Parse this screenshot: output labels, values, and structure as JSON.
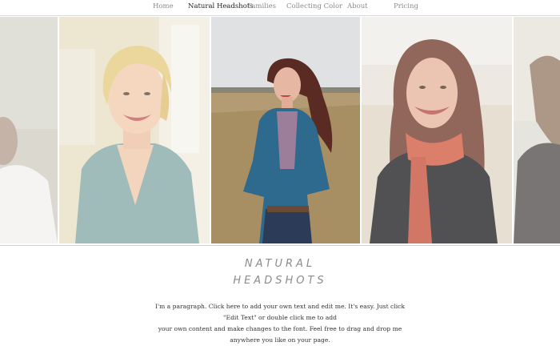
{
  "nav": {
    "items": [
      {
        "label": "Home"
      },
      {
        "label": "Natural Headshots"
      },
      {
        "label": "Families"
      },
      {
        "label": "Collecting Color"
      },
      {
        "label": "About"
      },
      {
        "label": "Pricing"
      }
    ],
    "active": "Natural Headshots"
  },
  "section": {
    "title_line1": "NATURAL",
    "title_line2": "HEADSHOTS",
    "paragraph_line1": "I'm a paragraph. Click here to add your own text and edit me. It's easy. Just click \"Edit Text\" or double click me to add",
    "paragraph_line2": "your own content and make changes to the font. Feel free to drag and drop me anywhere you like on your page."
  },
  "colors": {
    "nav_active": "#222222",
    "nav_inactive": "#8a8a8a",
    "title": "#8b8b8b"
  }
}
